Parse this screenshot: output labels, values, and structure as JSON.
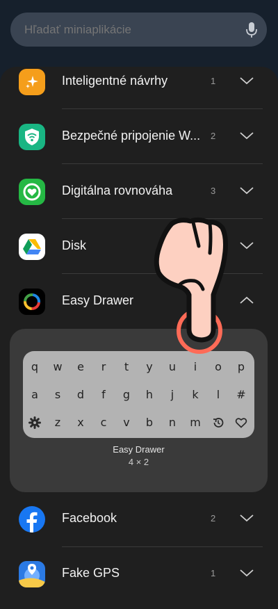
{
  "search": {
    "placeholder": "Hľadať miniaplikácie",
    "icon": "mic-icon"
  },
  "apps": [
    {
      "title": "Inteligentné návrhy",
      "count": "1",
      "icon": "sparkle-icon",
      "color": "#f5a623"
    },
    {
      "title": "Bezpečné pripojenie W...",
      "count": "2",
      "icon": "wifi-shield-icon",
      "color": "#1db97a"
    },
    {
      "title": "Digitálna rovnováha",
      "count": "3",
      "icon": "heart-ring-icon",
      "color": "#2fc34a"
    },
    {
      "title": "Disk",
      "count": "",
      "icon": "google-drive-icon",
      "color": "#ffffff"
    },
    {
      "title": "Easy Drawer",
      "count": "",
      "icon": "color-ring-icon",
      "color": "#000000",
      "expanded": true
    },
    {
      "title": "Facebook",
      "count": "2",
      "icon": "facebook-icon",
      "color": "#1877f2"
    },
    {
      "title": "Fake GPS",
      "count": "1",
      "icon": "globe-pin-icon",
      "color": "#2d7be5"
    }
  ],
  "widget": {
    "name": "Easy Drawer",
    "size": "4 × 2",
    "keys": {
      "row1": [
        "q",
        "w",
        "e",
        "r",
        "t",
        "y",
        "u",
        "i",
        "o",
        "p"
      ],
      "row2": [
        "a",
        "s",
        "d",
        "f",
        "g",
        "h",
        "j",
        "k",
        "l",
        "#"
      ],
      "row3": [
        "z",
        "x",
        "c",
        "v",
        "b",
        "n",
        "m"
      ]
    },
    "row3_icons": [
      "gear-icon",
      "history-icon",
      "heart-icon"
    ]
  }
}
